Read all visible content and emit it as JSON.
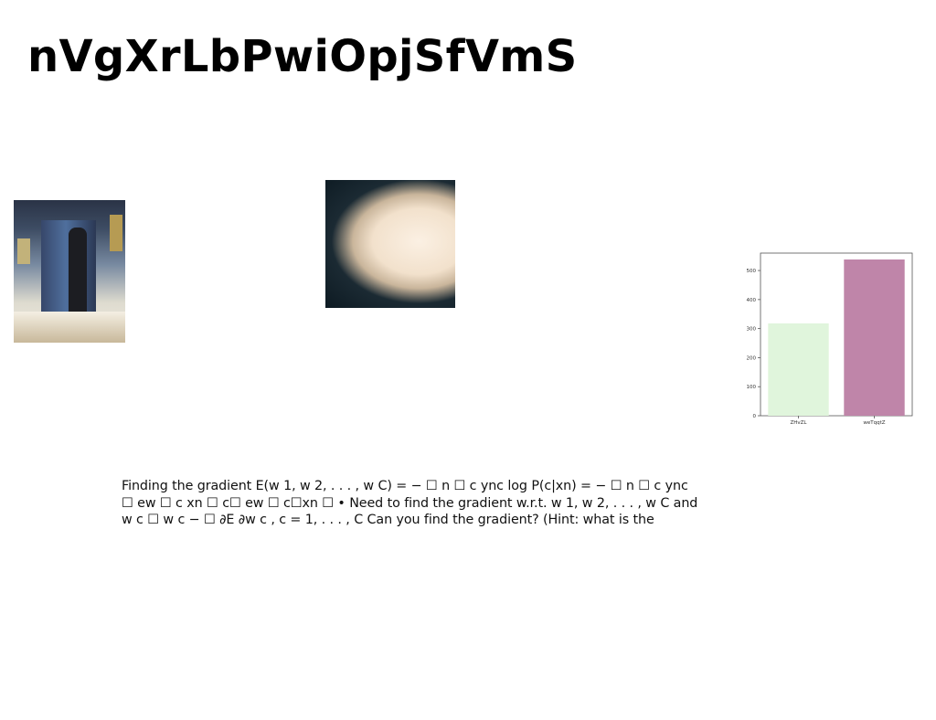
{
  "title": "nVgXrLbPwiOpjSfVmS",
  "body_lines": [
    "Finding the gradient E(w 1, w 2, . . . , w C) = − ☐ n ☐ c ync log P(c|xn) = − ☐ n ☐ c ync",
    "☐ ew ☐ c xn ☐ c☐ ew ☐ c☐xn ☐ • Need to find the gradient w.r.t. w 1, w 2, . . . , w C and",
    "w c ☐ w c − ☐ ∂E ∂w c , c = 1, . . . , C Can you find the gradient? (Hint: what is the"
  ],
  "chart_data": {
    "type": "bar",
    "categories": [
      "ZHvZL",
      "weTqqtZ"
    ],
    "values": [
      318,
      538
    ],
    "colors": [
      "#e0f5dc",
      "#bf85a9"
    ],
    "ylim": [
      0,
      560
    ],
    "yticks": [
      0,
      100,
      200,
      300,
      400,
      500
    ],
    "title": "",
    "xlabel": "",
    "ylabel": "",
    "grid": false
  }
}
